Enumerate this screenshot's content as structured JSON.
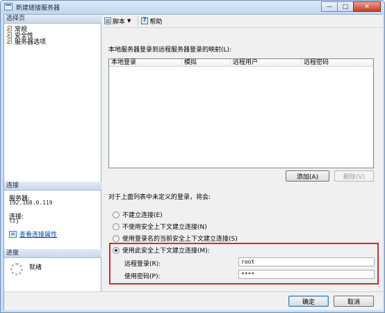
{
  "window": {
    "title": "新建链接服务器",
    "minimize": "—",
    "maximize": "□",
    "close": "✕"
  },
  "left": {
    "select_page_header": "选择页",
    "nav_items": [
      {
        "label": "常规",
        "icon": "page-icon"
      },
      {
        "label": "安全性",
        "icon": "page-icon"
      },
      {
        "label": "服务器选项",
        "icon": "page-icon"
      }
    ],
    "connection_header": "连接",
    "server_label": "服务器:",
    "server_value": "192.168.0.119",
    "connection_label": "连接:",
    "connection_value": "tzj",
    "view_props_link": "查看连接属性",
    "progress_header": "进度",
    "progress_status": "就绪"
  },
  "toolbar": {
    "script_label": "脚本",
    "help_label": "帮助"
  },
  "mapping": {
    "label": "本地服务器登录到远程服务器登录的映射(L):",
    "columns": [
      "本地登录",
      "模拟",
      "远程用户",
      "远程密码"
    ],
    "rows": [],
    "add_button": "添加(A)",
    "remove_button": "删除(V)"
  },
  "undefined_logins": {
    "label": "对于上面列表中未定义的登录，将会:",
    "options": [
      {
        "label": "不建立连接(E)",
        "selected": false
      },
      {
        "label": "不使用安全上下文建立连接(N)",
        "selected": false
      },
      {
        "label": "使用登录名的当前安全上下文建立连接(S)",
        "selected": false
      },
      {
        "label": "使用此安全上下文建立连接(M):",
        "selected": true
      }
    ],
    "remote_login_label": "远程登录(R):",
    "remote_login_value": "root",
    "password_label": "使用密码(P):",
    "password_value": "****"
  },
  "footer": {
    "ok_button": "确定",
    "cancel_button": "取消"
  }
}
